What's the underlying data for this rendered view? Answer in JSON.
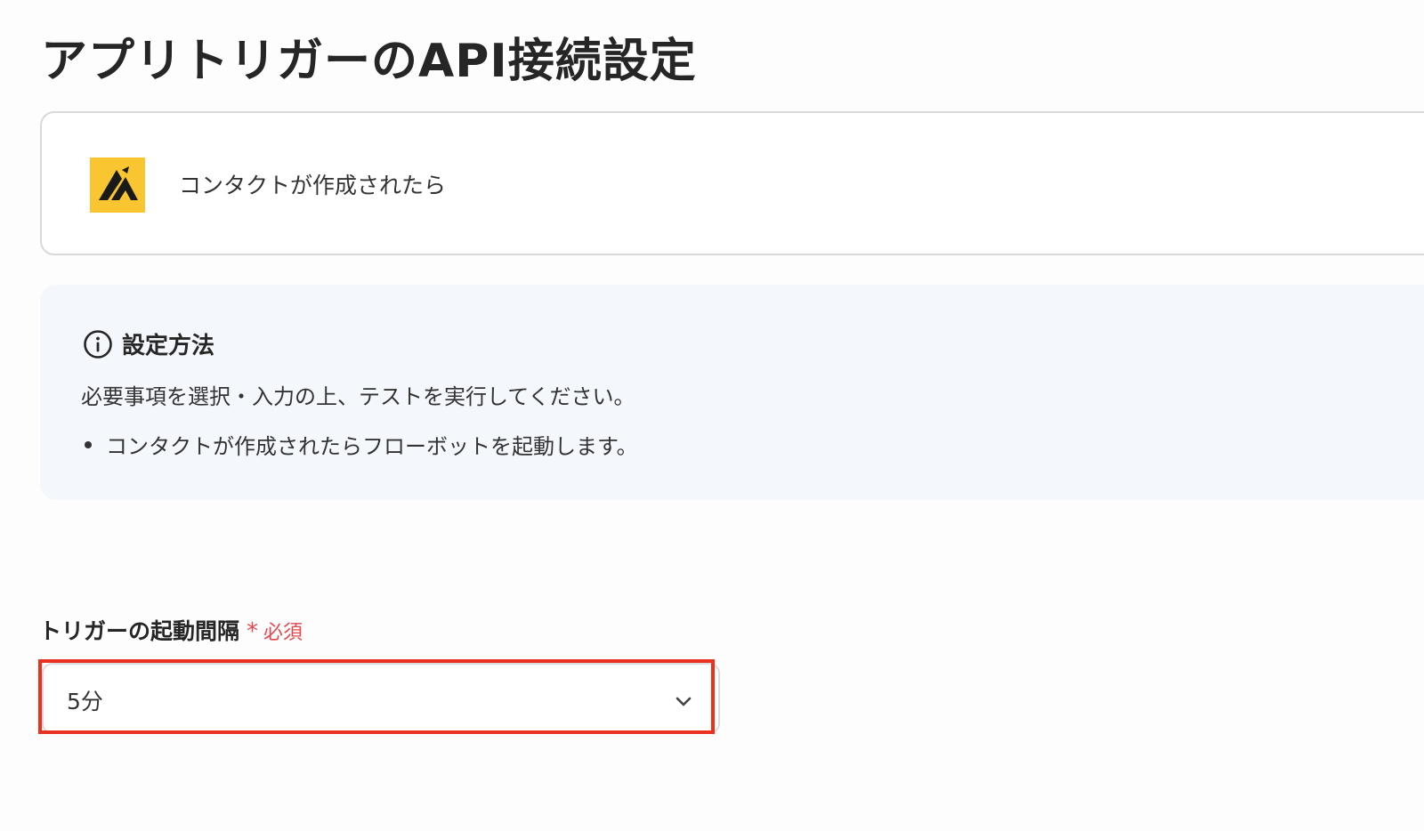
{
  "page": {
    "title": "アプリトリガーのAPI接続設定"
  },
  "trigger": {
    "app_icon": "app-logo-yellow-triangle",
    "name": "コンタクトが作成されたら"
  },
  "info": {
    "icon": "info-circle-icon",
    "heading": "設定方法",
    "description": "必要事項を選択・入力の上、テストを実行してください。",
    "bullets": [
      "コンタクトが作成されたらフローボットを起動します。"
    ]
  },
  "interval_field": {
    "label": "トリガーの起動間隔",
    "required_mark": "*",
    "required_text": "必須",
    "selected_value": "5分",
    "icon": "chevron-down-icon"
  },
  "colors": {
    "brand_yellow": "#f9c531",
    "required_red": "#e5484d",
    "highlight_red": "#e8311f",
    "info_bg": "#f4f7fb"
  }
}
